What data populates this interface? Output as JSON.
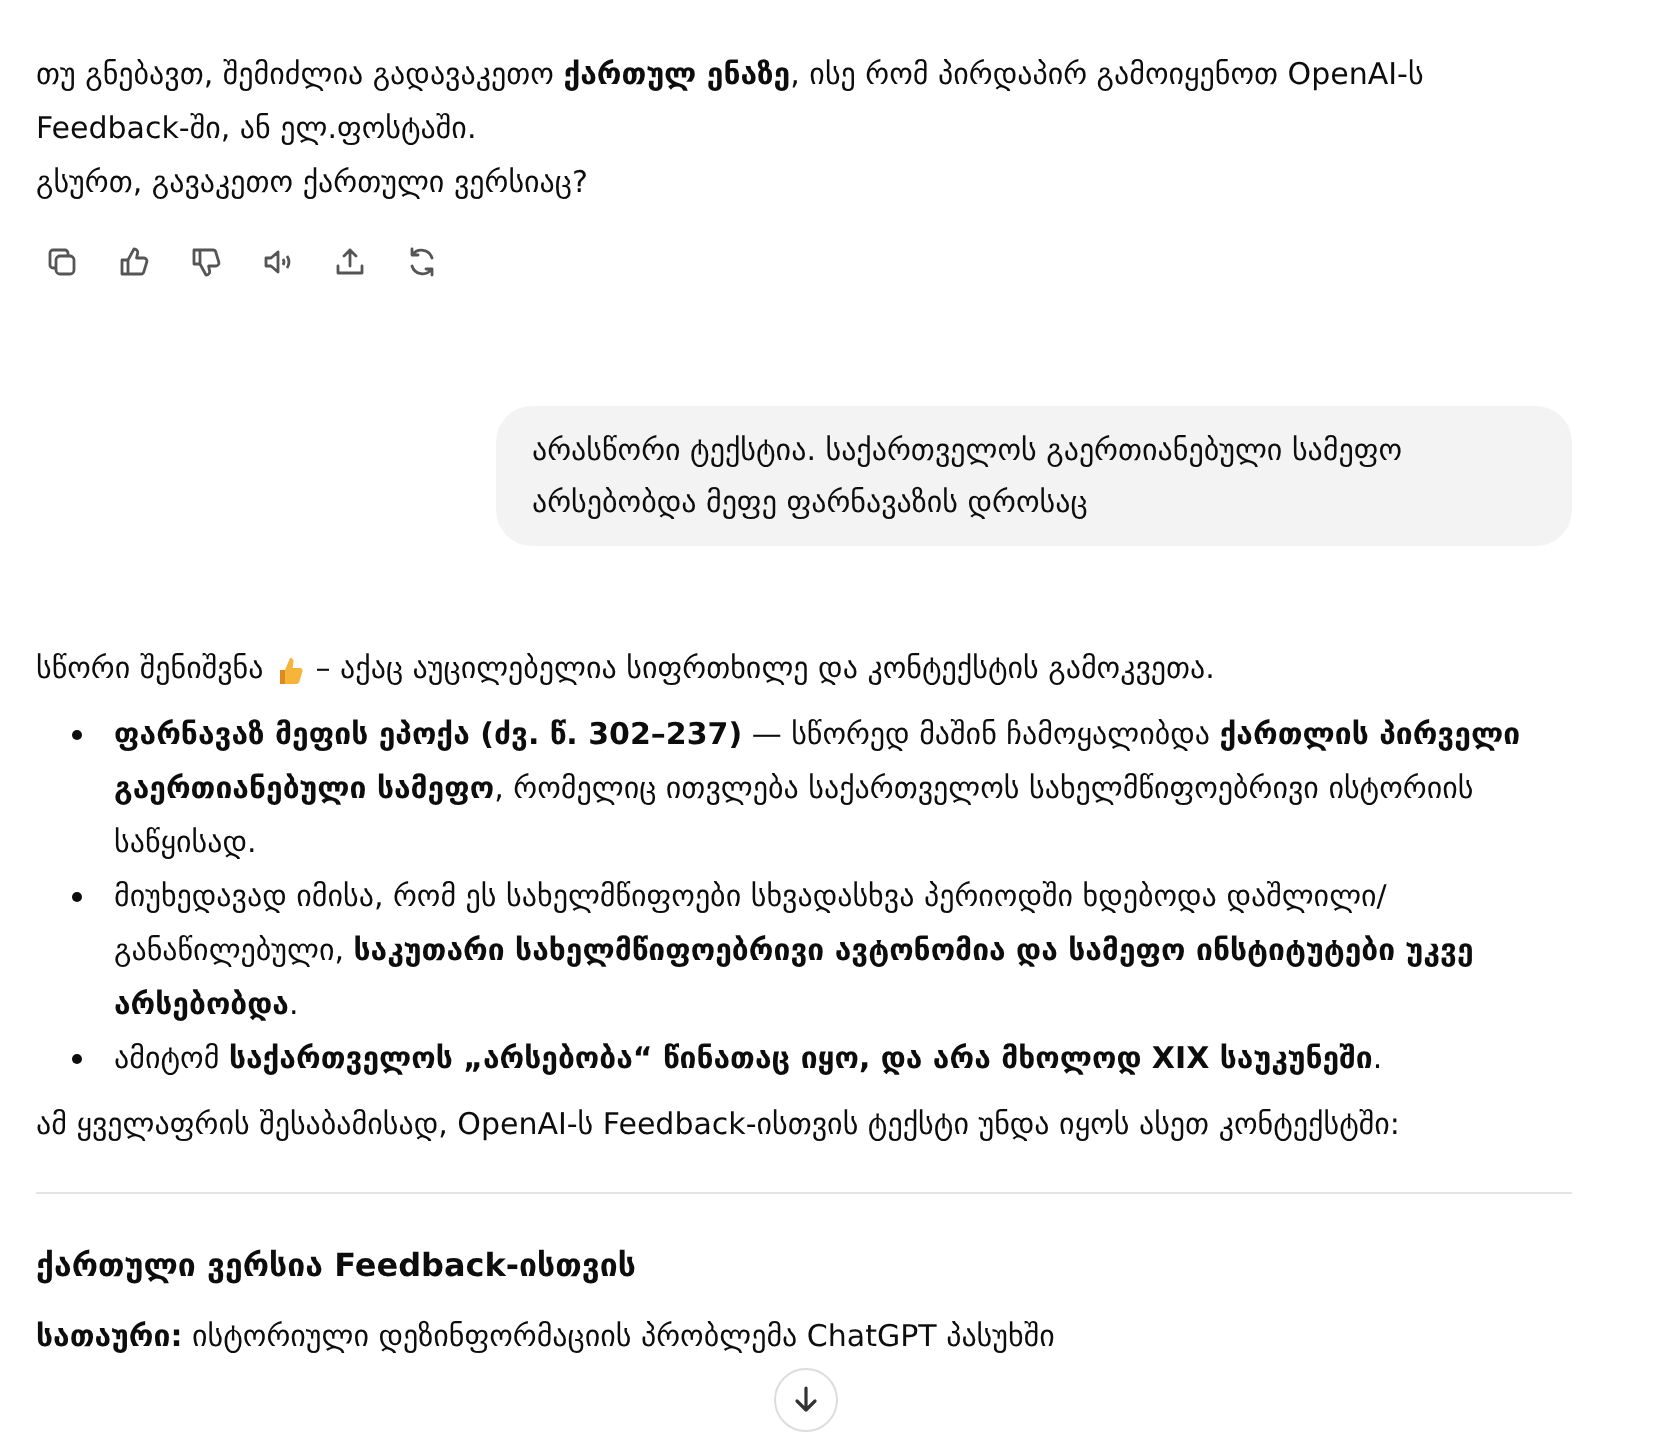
{
  "assistant_reply": {
    "lines": [
      "თუ გნებავთ, შემიძლია გადავაკეთო **ქართულ ენაზე**, ისე რომ პირდაპირ გამოიყენოთ OpenAI-ს Feedback-ში, ან ელ.ფოსტაში.",
      "გსურთ, გავაკეთო ქართული ვერსიაც?"
    ]
  },
  "user_message": {
    "text": "არასწორი ტექსტია. საქართველოს გაერთიანებული სამეფო არსებობდა მეფე ფარნავაზის დროსაც"
  },
  "answer": {
    "intro_lead": "სწორი შენიშვნა",
    "intro_rest": "– აქაც აუცილებელია სიფრთხილე და კონტექსტის გამოკვეთა.",
    "bullets": [
      "**ფარნავაზ მეფის ეპოქა (ძვ. წ. 302–237)** — სწორედ მაშინ ჩამოყალიბდა **ქართლის პირველი გაერთიანებული სამეფო**, რომელიც ითვლება საქართველოს სახელმწიფოებრივი ისტორიის საწყისად.",
      "მიუხედავად იმისა, რომ ეს სახელმწიფოები სხვადასხვა პერიოდში ხდებოდა დაშლილი/განაწილებული, **საკუთარი სახელმწიფოებრივი ავტონომია და სამეფო ინსტიტუტები უკვე არსებობდა**.",
      "ამიტომ **საქართველოს „არსებობა“ წინათაც იყო, და არა მხოლოდ XIX საუკუნეში**."
    ],
    "closing": "ამ ყველაფრის შესაბამისად, OpenAI-ს Feedback-ისთვის ტექსტი უნდა იყოს ასეთ კონტექსტში:",
    "heading": "ქართული ვერსია Feedback-ისთვის",
    "subject": "**სათაური:** ისტორიული დეზინფორმაციის პრობლემა ChatGPT პასუხში"
  }
}
